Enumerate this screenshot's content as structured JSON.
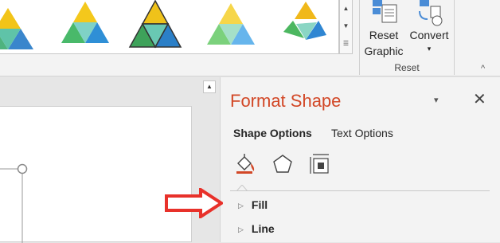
{
  "ribbon": {
    "reset_graphic_line1": "Reset",
    "reset_graphic_line2": "Graphic",
    "convert_label": "Convert",
    "convert_caret": "▾",
    "group_label": "Reset",
    "collapse_caret": "^"
  },
  "format_pane": {
    "title": "Format Shape",
    "dropdown_glyph": "▾",
    "close_glyph": "✕",
    "tabs": [
      "Shape Options",
      "Text Options"
    ],
    "sections": [
      "Fill",
      "Line"
    ],
    "section_glyph": "▷"
  },
  "colors": {
    "accent": "#d24726",
    "annotation_arrow": "#e8312a"
  }
}
